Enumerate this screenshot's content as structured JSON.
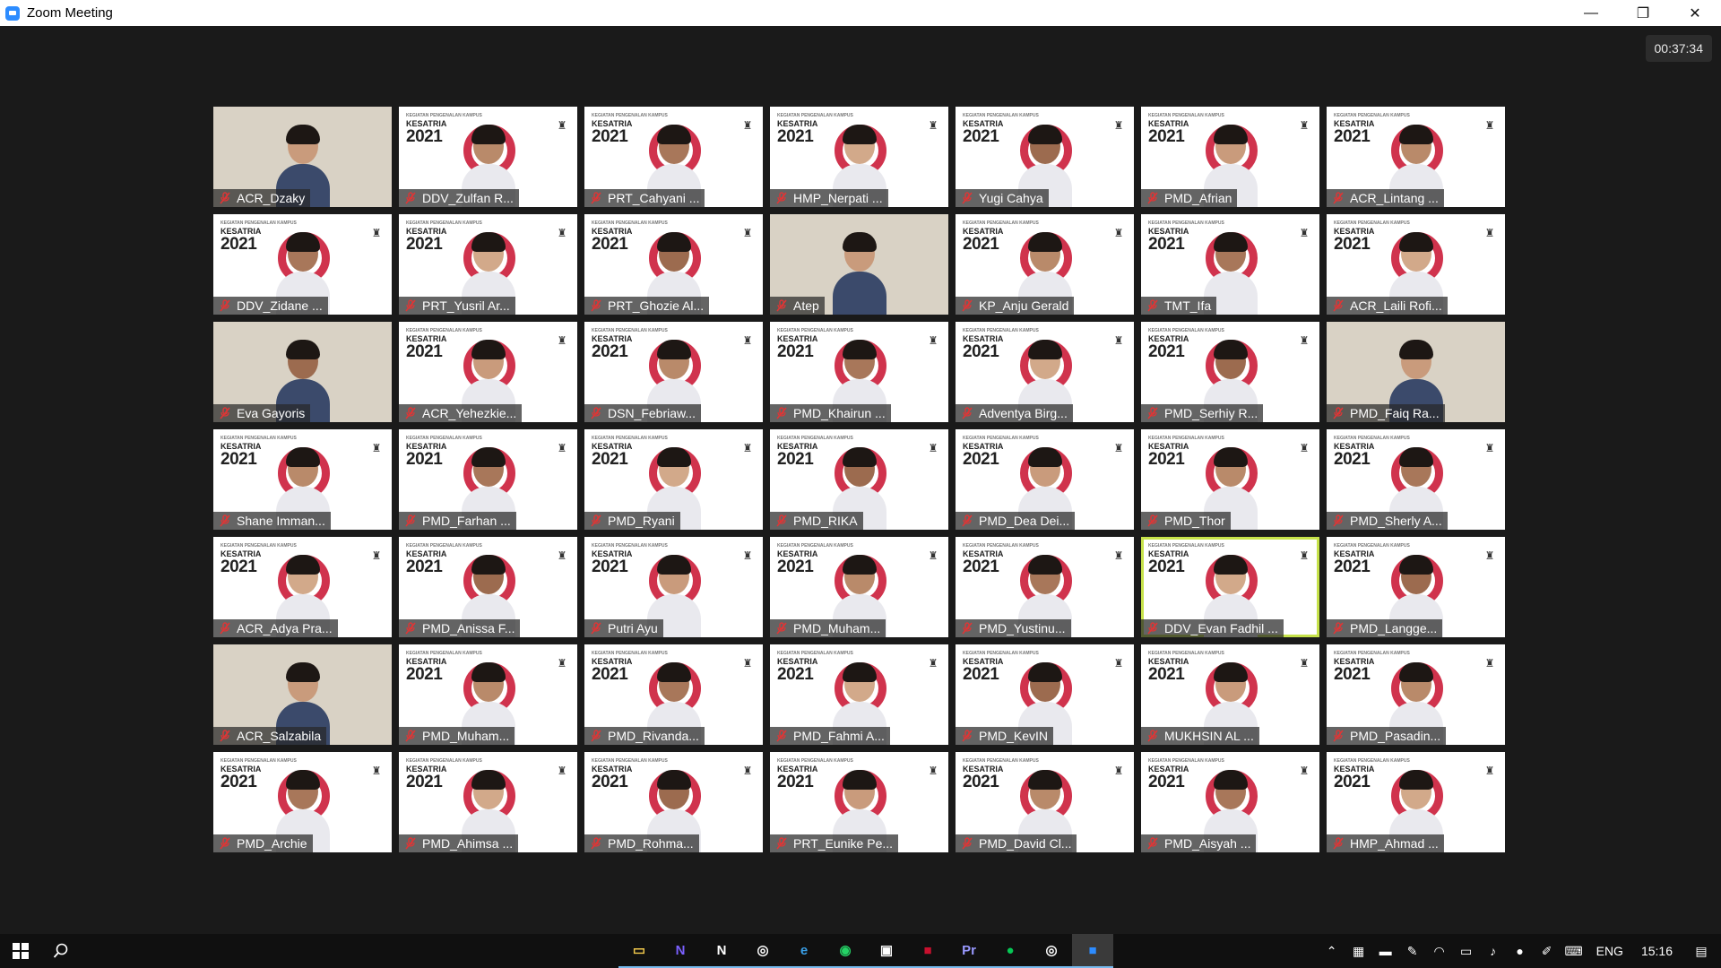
{
  "window": {
    "title": "Zoom Meeting",
    "minimize_glyph": "—",
    "restore_glyph": "❐",
    "close_glyph": "✕"
  },
  "meeting": {
    "timer": "00:37:34",
    "active_speaker_index": 33
  },
  "background_logo": {
    "line1": "KEGIATAN PENGENALAN KAMPUS",
    "line2": "KESATRIA",
    "line3": "2021"
  },
  "participants": [
    {
      "name": "ACR_Dzaky",
      "view": "camera"
    },
    {
      "name": "DDV_Zulfan R...",
      "view": "bg"
    },
    {
      "name": "PRT_Cahyani ...",
      "view": "bg"
    },
    {
      "name": "HMP_Nerpati ...",
      "view": "bg"
    },
    {
      "name": "Yugi Cahya",
      "view": "bg"
    },
    {
      "name": "PMD_Afrian",
      "view": "bg"
    },
    {
      "name": "ACR_Lintang ...",
      "view": "bg"
    },
    {
      "name": "DDV_Zidane ...",
      "view": "bg"
    },
    {
      "name": "PRT_Yusril Ar...",
      "view": "bg"
    },
    {
      "name": "PRT_Ghozie Al...",
      "view": "bg"
    },
    {
      "name": "Atep",
      "view": "camera"
    },
    {
      "name": "KP_Anju Gerald",
      "view": "bg"
    },
    {
      "name": "TMT_Ifa",
      "view": "bg"
    },
    {
      "name": "ACR_Laili Rofi...",
      "view": "bg"
    },
    {
      "name": "Eva Gayoris",
      "view": "camera"
    },
    {
      "name": "ACR_Yehezkie...",
      "view": "bg"
    },
    {
      "name": "DSN_Febriaw...",
      "view": "bg"
    },
    {
      "name": "PMD_Khairun ...",
      "view": "bg"
    },
    {
      "name": "Adventya Birg...",
      "view": "bg"
    },
    {
      "name": "PMD_Serhiy R...",
      "view": "bg"
    },
    {
      "name": "PMD_Faiq Ra...",
      "view": "camera"
    },
    {
      "name": "Shane Imman...",
      "view": "bg"
    },
    {
      "name": "PMD_Farhan ...",
      "view": "bg"
    },
    {
      "name": "PMD_Ryani",
      "view": "bg"
    },
    {
      "name": "PMD_RIKA",
      "view": "bg"
    },
    {
      "name": "PMD_Dea Dei...",
      "view": "bg"
    },
    {
      "name": "PMD_Thor",
      "view": "bg"
    },
    {
      "name": "PMD_Sherly A...",
      "view": "bg"
    },
    {
      "name": "ACR_Adya Pra...",
      "view": "bg"
    },
    {
      "name": "PMD_Anissa F...",
      "view": "bg"
    },
    {
      "name": "Putri Ayu",
      "view": "bg"
    },
    {
      "name": "PMD_Muham...",
      "view": "bg"
    },
    {
      "name": "PMD_Yustinu...",
      "view": "bg"
    },
    {
      "name": "DDV_Evan Fadhil ...",
      "view": "bg"
    },
    {
      "name": "PMD_Langge...",
      "view": "bg"
    },
    {
      "name": "ACR_Salzabila",
      "view": "camera"
    },
    {
      "name": "PMD_Muham...",
      "view": "bg"
    },
    {
      "name": "PMD_Rivanda...",
      "view": "bg"
    },
    {
      "name": "PMD_Fahmi A...",
      "view": "bg"
    },
    {
      "name": "PMD_KevIN",
      "view": "bg"
    },
    {
      "name": "MUKHSIN AL ...",
      "view": "bg"
    },
    {
      "name": "PMD_Pasadin...",
      "view": "bg"
    },
    {
      "name": "PMD_Archie",
      "view": "bg"
    },
    {
      "name": "PMD_Ahimsa ...",
      "view": "bg"
    },
    {
      "name": "PMD_Rohma...",
      "view": "bg"
    },
    {
      "name": "PRT_Eunike Pe...",
      "view": "bg"
    },
    {
      "name": "PMD_David Cl...",
      "view": "bg"
    },
    {
      "name": "PMD_Aisyah ...",
      "view": "bg"
    },
    {
      "name": "HMP_Ahmad ...",
      "view": "bg"
    }
  ],
  "taskbar": {
    "apps": [
      {
        "icon": "file-explorer-icon",
        "glyph": "▭"
      },
      {
        "icon": "onenote-icon",
        "glyph": "N"
      },
      {
        "icon": "notion-icon",
        "glyph": "N"
      },
      {
        "icon": "chrome-icon",
        "glyph": "◎"
      },
      {
        "icon": "edge-icon",
        "glyph": "e"
      },
      {
        "icon": "whatsapp-icon",
        "glyph": "◉"
      },
      {
        "icon": "remote-desktop-icon",
        "glyph": "▣"
      },
      {
        "icon": "app-red-icon",
        "glyph": "■"
      },
      {
        "icon": "premiere-icon",
        "glyph": "Pr"
      },
      {
        "icon": "line-icon",
        "glyph": "●"
      },
      {
        "icon": "chrome-icon",
        "glyph": "◎"
      },
      {
        "icon": "zoom-icon",
        "glyph": "■"
      }
    ],
    "language": "ENG",
    "time": "15:16"
  },
  "colors": {
    "accent_red": "#c8102e",
    "active_speaker_border": "#c6e24a",
    "muted_mic": "#e03535"
  }
}
